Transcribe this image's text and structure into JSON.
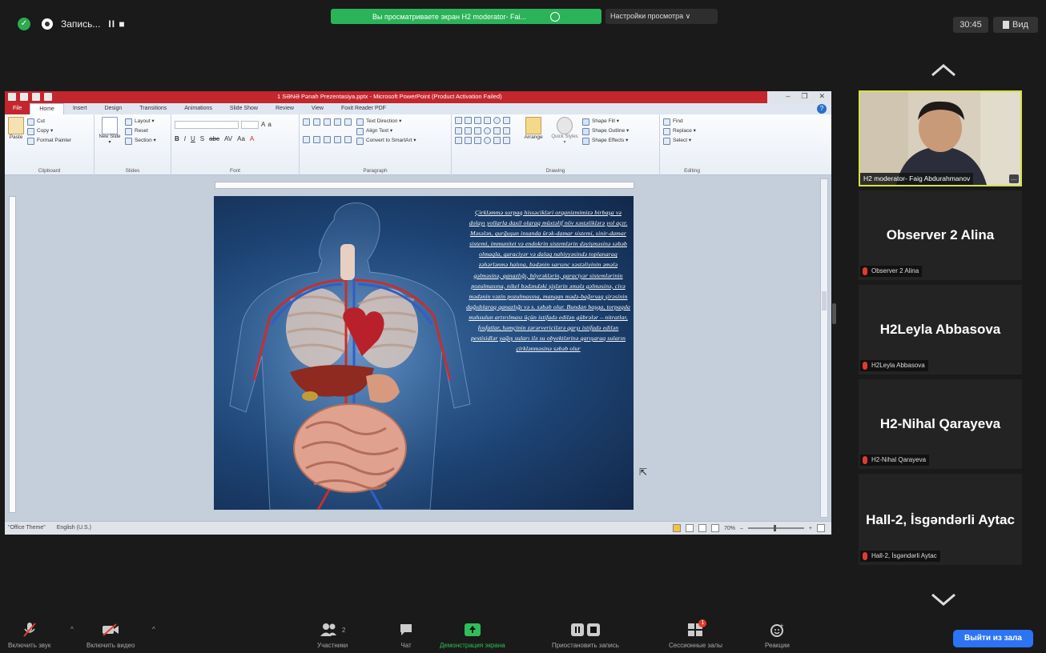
{
  "top": {
    "recording_label": "Запись...",
    "recording_controls": "II ■",
    "share_banner": "Вы просматриваете экран H2 moderator- Fai...",
    "view_options": "Настройки просмотра ∨",
    "clock": "30:45",
    "view_button": "Вид"
  },
  "powerpoint": {
    "title": "1 SƏNƏ Pənah Prezentasiya.pptx - Microsoft PowerPoint (Product Activation Failed)",
    "tabs": [
      "File",
      "Home",
      "Insert",
      "Design",
      "Transitions",
      "Animations",
      "Slide Show",
      "Review",
      "View",
      "Foxit Reader PDF"
    ],
    "groups": {
      "clipboard": {
        "label": "Clipboard",
        "paste": "Paste",
        "cut": "Cut",
        "copy": "Copy ▾",
        "format_painter": "Format Painter"
      },
      "slides": {
        "label": "Slides",
        "new_slide": "New Slide ▾",
        "layout": "Layout ▾",
        "reset": "Reset",
        "section": "Section ▾"
      },
      "font": {
        "label": "Font"
      },
      "paragraph": {
        "label": "Paragraph",
        "text_direction": "Text Direction ▾",
        "align_text": "Align Text ▾",
        "convert": "Convert to SmartArt ▾"
      },
      "drawing": {
        "label": "Drawing",
        "arrange": "Arrange",
        "quick_styles": "Quick Styles ▾",
        "shape_fill": "Shape Fill ▾",
        "shape_outline": "Shape Outline ▾",
        "shape_effects": "Shape Effects ▾"
      },
      "editing": {
        "label": "Editing",
        "find": "Find",
        "replace": "Replace ▾",
        "select": "Select ▾"
      }
    },
    "slide_text": "Çirkləmmə sorpaq hissəcikləri orqanizmimizə birbaşa və dolayı yollarla daxil olaraq müxtəlif növ xəstəliklərə yol açır. Məsələn, qurğuşun insanda ürək-damar sistemi, sinir-damar sistemi, immunitet və endokrin sistemlərin dəyişməsinə səbəb olmaqla, qaraciyər və dalaq nahiyyəsində toplanaraq zəhərlənmə halına, bədənin sarsınc xəstəliyinin əmələ gəlməsinə, qanazlığı, böyrəklərin, qaraciyər sistemlərinin pozulmasına, nikel bədəndəki şişlərin əmələ gəlməsinə, civə mədənin vəzin pozulmasına, manqan mədə-bağırsaq şirəsinin dağıdılaraq qanazlığı və s. səbəb olur. Bundan başqa, torpaqda məhsulun artırılması üçün istifadə edilən gübrələr – nitratlar, fosfatlar, həmçinin zərərvericilərə qarşı istifadə edilən pestisidlər yağış suları ilə su obyektlərinə qarışaraq suların çirklənməsinə səbəb olur",
    "status": {
      "theme": "\"Office Theme\"",
      "language": "English (U.S.)",
      "zoom": "70%"
    }
  },
  "participants": [
    {
      "name": "H2 moderator- Faig Abdurahmanov",
      "video": true
    },
    {
      "name": "Observer 2 Alina",
      "tag": "Observer 2 Alina"
    },
    {
      "name": "H2Leyla Abbasova",
      "tag": "H2Leyla Abbasova"
    },
    {
      "name": "H2-Nihal Qarayeva",
      "tag": "H2-Nihal Qarayeva"
    },
    {
      "name": "Hall-2, İsgəndərli Aytac",
      "tag": "Hall-2, İsgəndərli Aytac"
    }
  ],
  "toolbar": {
    "audio": "Включить звук",
    "video": "Включить видео",
    "participants": "Участники",
    "chat": "Чат",
    "share": "Демонстрация экрана",
    "pause_record": "Приостановить запись",
    "breakout": "Сессионные залы",
    "reactions": "Реакции",
    "leave": "Выйти из зала",
    "participants_count": "2",
    "breakout_badge": "1"
  }
}
